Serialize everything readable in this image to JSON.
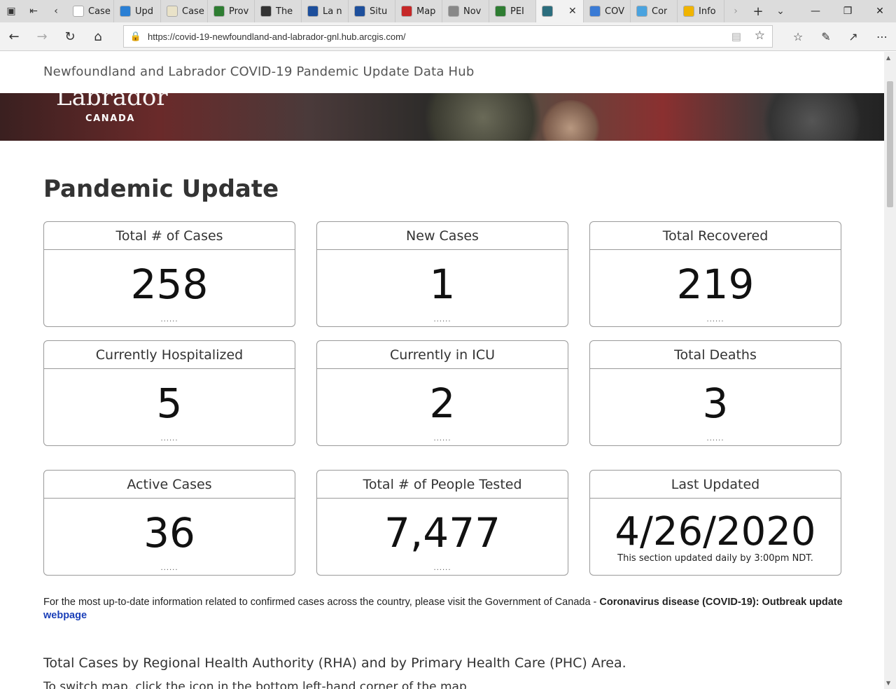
{
  "browser": {
    "tabs": [
      {
        "label": "Case",
        "color": "#ffffff",
        "icon": "page-icon"
      },
      {
        "label": "Upd",
        "color": "#2a7fd4",
        "icon": "chart-icon"
      },
      {
        "label": "Case",
        "color": "#e9e2c8",
        "icon": "doc-icon"
      },
      {
        "label": "Prov",
        "color": "#2e7d32",
        "icon": "flag-icon"
      },
      {
        "label": "The",
        "color": "#333333",
        "icon": "shield-icon"
      },
      {
        "label": "La n",
        "color": "#1d4f9c",
        "icon": "fleur-icon"
      },
      {
        "label": "Situ",
        "color": "#1d4f9c",
        "icon": "fleur-icon"
      },
      {
        "label": "Map",
        "color": "#c62828",
        "icon": "map-icon"
      },
      {
        "label": "Nov",
        "color": "#888888",
        "icon": "doc-icon"
      },
      {
        "label": "PEI",
        "color": "#2e7d32",
        "icon": "pei-icon"
      },
      {
        "label": "",
        "color": "#2c6e7e",
        "icon": "globe-icon",
        "active": true
      },
      {
        "label": "COV",
        "color": "#3a7bd5",
        "icon": "cov-icon"
      },
      {
        "label": "Cor",
        "color": "#4aa3df",
        "icon": "cor-icon"
      },
      {
        "label": "Info",
        "color": "#f0b400",
        "icon": "info-icon"
      }
    ],
    "url": "https://covid-19-newfoundland-and-labrador-gnl.hub.arcgis.com/"
  },
  "site": {
    "title": "Newfoundland and Labrador COVID-19 Pandemic Update Data Hub",
    "logo_word": "Labrador",
    "logo_sub": "CANADA"
  },
  "main": {
    "heading": "Pandemic Update",
    "cards": [
      {
        "label": "Total # of Cases",
        "value": "258",
        "foot": "......"
      },
      {
        "label": "New Cases",
        "value": "1",
        "foot": "......"
      },
      {
        "label": "Total Recovered",
        "value": "219",
        "foot": "......"
      },
      {
        "label": "Currently Hospitalized",
        "value": "5",
        "foot": "......"
      },
      {
        "label": "Currently in ICU",
        "value": "2",
        "foot": "......"
      },
      {
        "label": "Total Deaths",
        "value": "3",
        "foot": "......"
      },
      {
        "label": "Active Cases",
        "value": "36",
        "foot": "......"
      },
      {
        "label": "Total # of People Tested",
        "value": "7,477",
        "foot": "......"
      },
      {
        "label": "Last Updated",
        "value": "4/26/2020",
        "note": "This section updated daily by 3:00pm NDT."
      }
    ],
    "info_text": "For the most up-to-date information related to confirmed cases across the country, please visit the Government of Canada - ",
    "info_bold": "Coronavirus disease (COVID-19): Outbreak update",
    "info_link": "webpage",
    "section_heading": "Total Cases by Regional Health Authority (RHA) and by Primary Health Care (PHC) Area.",
    "section_sub": "To switch map, click the icon in the bottom left-hand corner of the map"
  }
}
